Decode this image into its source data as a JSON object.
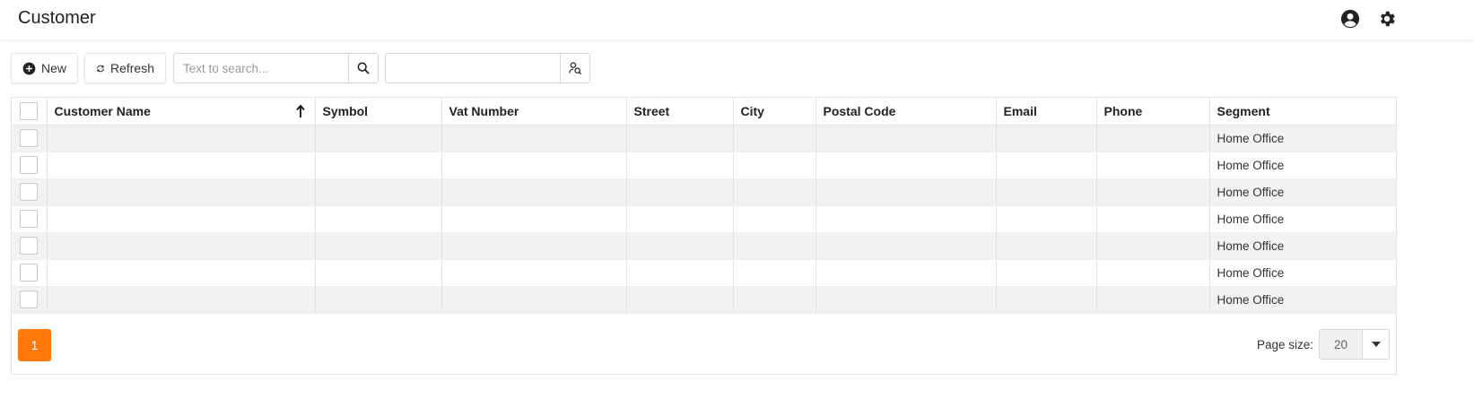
{
  "header": {
    "title": "Customer"
  },
  "toolbar": {
    "new_label": "New",
    "refresh_label": "Refresh",
    "search_placeholder": "Text to search...",
    "search_value": "",
    "filter_value": ""
  },
  "grid": {
    "columns": [
      "Customer Name",
      "Symbol",
      "Vat Number",
      "Street",
      "City",
      "Postal Code",
      "Email",
      "Phone",
      "Segment"
    ],
    "sorted_column": "Customer Name",
    "sort_direction": "ascending",
    "rows": [
      {
        "customer_name": "",
        "symbol": "",
        "vat_number": "",
        "street": "",
        "city": "",
        "postal_code": "",
        "email": "",
        "phone": "",
        "segment": "Home Office"
      },
      {
        "customer_name": "",
        "symbol": "",
        "vat_number": "",
        "street": "",
        "city": "",
        "postal_code": "",
        "email": "",
        "phone": "",
        "segment": "Home Office"
      },
      {
        "customer_name": "",
        "symbol": "",
        "vat_number": "",
        "street": "",
        "city": "",
        "postal_code": "",
        "email": "",
        "phone": "",
        "segment": "Home Office"
      },
      {
        "customer_name": "",
        "symbol": "",
        "vat_number": "",
        "street": "",
        "city": "",
        "postal_code": "",
        "email": "",
        "phone": "",
        "segment": "Home Office"
      },
      {
        "customer_name": "",
        "symbol": "",
        "vat_number": "",
        "street": "",
        "city": "",
        "postal_code": "",
        "email": "",
        "phone": "",
        "segment": "Home Office"
      },
      {
        "customer_name": "",
        "symbol": "",
        "vat_number": "",
        "street": "",
        "city": "",
        "postal_code": "",
        "email": "",
        "phone": "",
        "segment": "Home Office"
      },
      {
        "customer_name": "",
        "symbol": "",
        "vat_number": "",
        "street": "",
        "city": "",
        "postal_code": "",
        "email": "",
        "phone": "",
        "segment": "Home Office"
      }
    ]
  },
  "pager": {
    "current_page": "1",
    "page_size_label": "Page size:",
    "page_size": "20"
  },
  "colors": {
    "accent": "#ff7a0a",
    "stripe": "#f2f2f2",
    "border": "#e3e3e3"
  },
  "icons": [
    "user-circle-icon",
    "gear-icon",
    "plus-circle-icon",
    "refresh-icon",
    "search-icon",
    "user-search-icon",
    "sort-ascending-icon",
    "caret-down-icon"
  ]
}
